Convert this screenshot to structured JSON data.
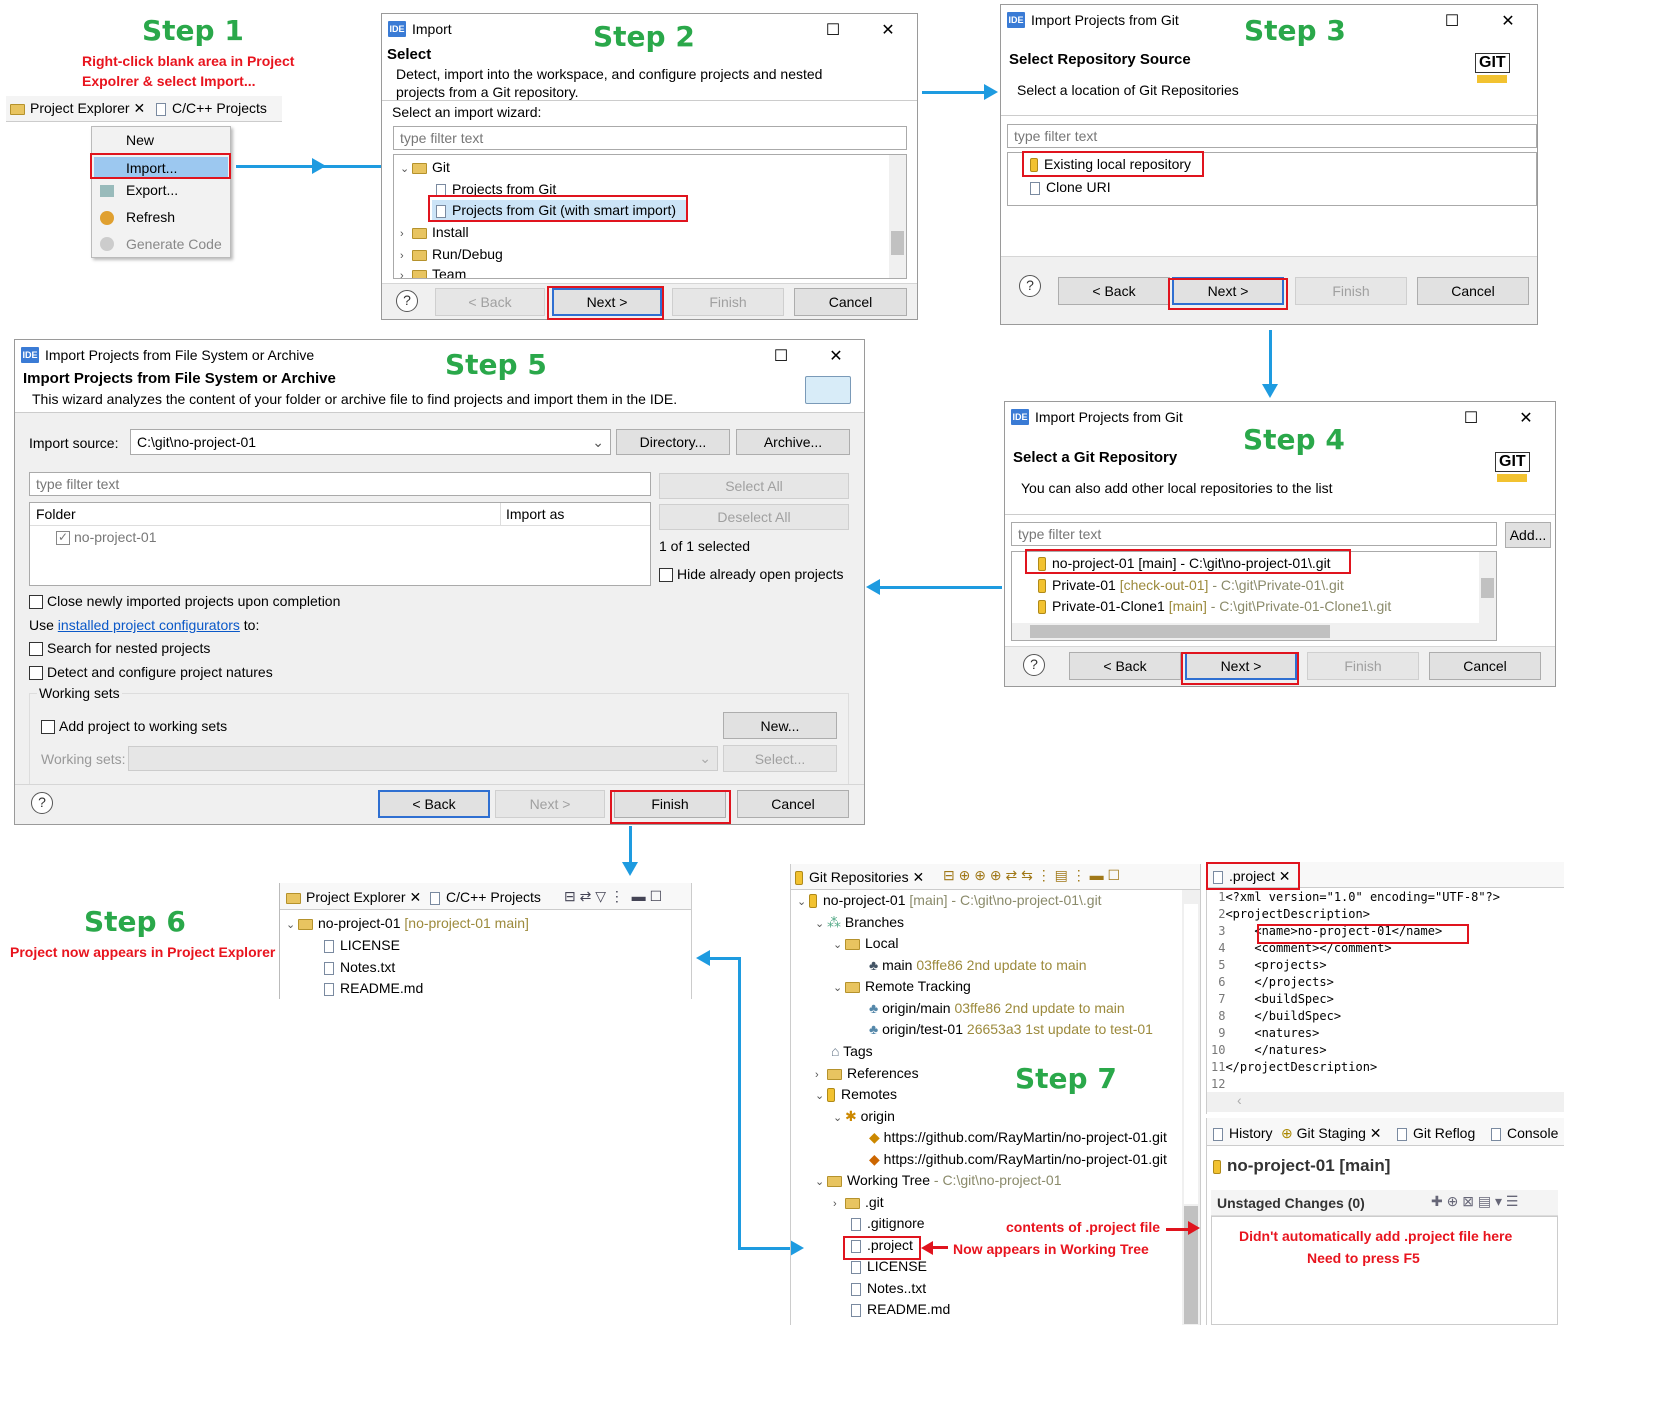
{
  "steps": {
    "s1": "Step 1",
    "s2": "Step 2",
    "s3": "Step 3",
    "s4": "Step 4",
    "s5": "Step 5",
    "s6": "Step 6",
    "s7": "Step 7"
  },
  "step1": {
    "note_line1": "Right-click blank area in Project",
    "note_line2": "Expolrer & select Import...",
    "tab_project_explorer": "Project Explorer",
    "tab_cpp": "C/C++ Projects",
    "menu": [
      "New",
      "Import...",
      "Export...",
      "Refresh",
      "Generate Code"
    ]
  },
  "step2": {
    "title": "Import",
    "heading": "Select",
    "desc_line1": "Detect, import into the workspace, and configure projects and nested",
    "desc_line2": "projects from a Git repository.",
    "wizard_label": "Select an import wizard:",
    "filter_placeholder": "type filter text",
    "tree": [
      "Git",
      "Projects from Git",
      "Projects from Git (with smart import)",
      "Install",
      "Run/Debug",
      "Team"
    ],
    "buttons": {
      "back": "< Back",
      "next": "Next >",
      "finish": "Finish",
      "cancel": "Cancel"
    }
  },
  "step3": {
    "title": "Import Projects from Git",
    "heading": "Select Repository Source",
    "desc": "Select a location of Git Repositories",
    "filter_placeholder": "type filter text",
    "items": [
      "Existing local repository",
      "Clone URI"
    ],
    "buttons": {
      "back": "< Back",
      "next": "Next >",
      "finish": "Finish",
      "cancel": "Cancel"
    },
    "logo": "GIT"
  },
  "step4": {
    "title": "Import Projects from Git",
    "heading": "Select a Git Repository",
    "desc": "You can also add other local repositories to the list",
    "filter_placeholder": "type filter text",
    "add": "Add...",
    "repos": [
      {
        "name": "no-project-01 [main] - C:\\git\\no-project-01\\.git",
        "branch": "",
        "path": ""
      },
      {
        "name": "Private-01",
        "branch": "[check-out-01]",
        "path": "- C:\\git\\Private-01\\.git"
      },
      {
        "name": "Private-01-Clone1",
        "branch": "[main]",
        "path": "- C:\\git\\Private-01-Clone1\\.git"
      }
    ],
    "buttons": {
      "back": "< Back",
      "next": "Next >",
      "finish": "Finish",
      "cancel": "Cancel"
    },
    "logo": "GIT"
  },
  "step5": {
    "title": "Import Projects from File System or Archive",
    "heading": "Import Projects from File System or Archive",
    "desc": "This wizard analyzes the content of your folder or archive file to find projects and import them in the IDE.",
    "import_source_label": "Import source:",
    "import_source_value": "C:\\git\\no-project-01",
    "directory": "Directory...",
    "archive": "Archive...",
    "filter_placeholder": "type filter text",
    "col_folder": "Folder",
    "col_import_as": "Import as",
    "row": "no-project-01",
    "select_all": "Select All",
    "deselect_all": "Deselect All",
    "selected_count": "1 of 1 selected",
    "hide_open": "Hide already open projects",
    "close_newly": "Close newly imported projects upon completion",
    "use": "Use",
    "configurators_link": "installed project configurators",
    "to": "to:",
    "search_nested": "Search for nested projects",
    "detect_natures": "Detect and configure project natures",
    "working_sets": "Working sets",
    "add_to_ws": "Add project to working sets",
    "new": "New...",
    "ws_label": "Working sets:",
    "select": "Select...",
    "buttons": {
      "back": "< Back",
      "next": "Next >",
      "finish": "Finish",
      "cancel": "Cancel"
    }
  },
  "step6": {
    "note": "Project now appears in Project Explorer",
    "tab_project_explorer": "Project Explorer",
    "tab_cpp": "C/C++ Projects",
    "project": "no-project-01",
    "project_branch": "[no-project-01 main]",
    "files": [
      "LICENSE",
      "Notes.txt",
      "README.md"
    ]
  },
  "step7": {
    "tab": "Git Repositories",
    "repo": "no-project-01",
    "repo_suffix": "[main] - C:\\git\\no-project-01\\.git",
    "branches": "Branches",
    "local": "Local",
    "main": "main",
    "main_info": "03ffe86 2nd update to main",
    "remote_tracking": "Remote Tracking",
    "origin_main": "origin/main",
    "origin_main_info": "03ffe86 2nd update to main",
    "origin_test": "origin/test-01",
    "origin_test_info": "26653a3 1st update to test-01",
    "tags": "Tags",
    "references": "References",
    "remotes": "Remotes",
    "origin": "origin",
    "url1": "https://github.com/RayMartin/no-project-01.git",
    "url2": "https://github.com/RayMartin/no-project-01.git",
    "working_tree": "Working Tree",
    "working_tree_path": "- C:\\git\\no-project-01",
    "wt_items": [
      ".git",
      ".gitignore",
      ".project",
      "LICENSE",
      "Notes..txt",
      "README.md"
    ],
    "note_contents": "contents of .project file",
    "note_appears": "Now appears in Working Tree",
    "editor_tab": ".project",
    "code_lines": [
      "<?xml version=\"1.0\" encoding=\"UTF-8\"?>",
      "<projectDescription>",
      "    <name>no-project-01</name>",
      "    <comment></comment>",
      "    <projects>",
      "    </projects>",
      "    <buildSpec>",
      "    </buildSpec>",
      "    <natures>",
      "    </natures>",
      "</projectDescription>",
      ""
    ],
    "bottom_tabs": [
      "History",
      "Git Staging",
      "Git Reflog",
      "Console"
    ],
    "staging_title": "no-project-01 [main]",
    "unstaged": "Unstaged Changes (0)",
    "note_line1": "Didn't  automatically add .project  file here",
    "note_line2": "Need to press F5"
  }
}
